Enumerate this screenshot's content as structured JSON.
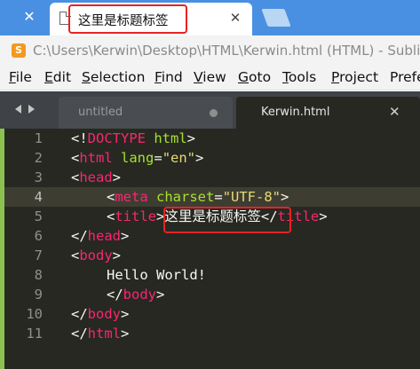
{
  "browser": {
    "tab_title": "这里是标题标签",
    "close_glyph": "✕"
  },
  "window": {
    "title": "C:\\Users\\Kerwin\\Desktop\\HTML\\Kerwin.html (HTML) - Subli"
  },
  "menu": [
    {
      "mnemonic": "F",
      "rest": "ile"
    },
    {
      "mnemonic": "E",
      "rest": "dit"
    },
    {
      "mnemonic": "S",
      "rest": "election"
    },
    {
      "mnemonic": "F",
      "rest": "ind"
    },
    {
      "mnemonic": "V",
      "rest": "iew"
    },
    {
      "mnemonic": "G",
      "rest": "oto"
    },
    {
      "mnemonic": "T",
      "rest": "ools"
    },
    {
      "mnemonic": "P",
      "rest": "roject"
    },
    {
      "mnemonic": "",
      "rest": "Prefe"
    }
  ],
  "editor_tabs": [
    {
      "label": "untitled",
      "active": false,
      "dirty": true
    },
    {
      "label": "Kerwin.html",
      "active": true,
      "close_glyph": "✕"
    }
  ],
  "code": {
    "line_numbers": [
      "1",
      "2",
      "3",
      "4",
      "5",
      "6",
      "7",
      "8",
      "9",
      "10",
      "11"
    ],
    "current_line": 4,
    "l1": {
      "p1": "<!",
      "kw": "DOCTYPE",
      "p2": " ",
      "attr": "html",
      "p3": ">"
    },
    "l2": {
      "p1": "<",
      "tag": "html",
      "p2": " ",
      "attr": "lang",
      "p3": "=",
      "str": "\"en\"",
      "p4": ">"
    },
    "l3": {
      "p1": "<",
      "tag": "head",
      "p2": ">"
    },
    "l4": {
      "p1": "<",
      "tag": "meta",
      "p2": " ",
      "attr": "charset",
      "p3": "=",
      "str": "\"UTF-8\"",
      "p4": ">"
    },
    "l5": {
      "p1": "<",
      "tag": "title",
      "p2": ">",
      "text": "这里是标题标签",
      "p3": "</",
      "tag2": "title",
      "p4": ">"
    },
    "l6": {
      "p1": "</",
      "tag": "head",
      "p2": ">"
    },
    "l7": {
      "p1": "<",
      "tag": "body",
      "p2": ">"
    },
    "l8": {
      "text": "Hello World!"
    },
    "l9": {
      "p1": "</",
      "tag": "body",
      "p2": ">"
    },
    "l10": {
      "p1": "</",
      "tag": "body",
      "p2": ">"
    },
    "l11": {
      "p1": "</",
      "tag": "html",
      "p2": ">"
    }
  },
  "colors": {
    "highlight_box": "#e52323",
    "tag": "#f92672",
    "attribute": "#a6e22e",
    "string": "#e6db74",
    "editor_bg": "#272822",
    "browser_bar": "#4a90e2",
    "gutter_marker": "#8cc152"
  },
  "icons": {
    "browser_tab": "document-icon",
    "app": "sublime-text-icon",
    "nav": "chevron-left-right-icons",
    "dirty": "unsaved-dot-icon"
  }
}
